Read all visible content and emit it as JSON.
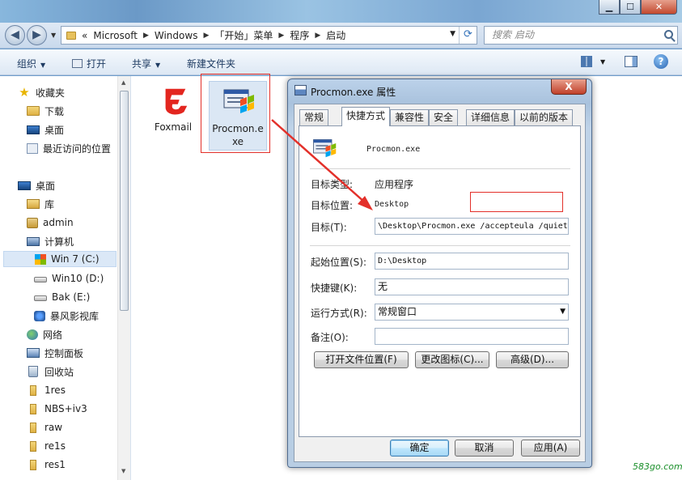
{
  "window": {
    "minimize_icon": "minimize-icon",
    "maximize_icon": "maximize-icon",
    "close_icon": "close-icon"
  },
  "navigation": {
    "back_icon": "back-arrow-icon",
    "forward_icon": "forward-arrow-icon",
    "overflow": "«",
    "breadcrumbs": [
      "Microsoft",
      "Windows",
      "「开始」菜单",
      "程序",
      "启动"
    ],
    "search_placeholder": "搜索 启动"
  },
  "toolbar": {
    "organize": "组织",
    "open": "打开",
    "share": "共享",
    "new_folder": "新建文件夹"
  },
  "sidebar": {
    "items": [
      {
        "label": "收藏夹",
        "icon": "star-icon"
      },
      {
        "label": "下载",
        "icon": "download-folder-icon"
      },
      {
        "label": "桌面",
        "icon": "desktop-icon"
      },
      {
        "label": "最近访问的位置",
        "icon": "recent-places-icon"
      },
      {
        "label": "桌面",
        "icon": "desktop-icon"
      },
      {
        "label": "库",
        "icon": "library-icon"
      },
      {
        "label": "admin",
        "icon": "user-folder-icon"
      },
      {
        "label": "计算机",
        "icon": "computer-icon"
      },
      {
        "label": "Win 7 (C:)",
        "icon": "windows-drive-icon"
      },
      {
        "label": "Win10 (D:)",
        "icon": "drive-icon"
      },
      {
        "label": "Bak (E:)",
        "icon": "drive-icon"
      },
      {
        "label": "暴风影视库",
        "icon": "media-library-icon"
      },
      {
        "label": "网络",
        "icon": "network-icon"
      },
      {
        "label": "控制面板",
        "icon": "control-panel-icon"
      },
      {
        "label": "回收站",
        "icon": "recycle-bin-icon"
      },
      {
        "label": "1res",
        "icon": "folder-icon"
      },
      {
        "label": "NBS+iv3",
        "icon": "folder-icon"
      },
      {
        "label": "raw",
        "icon": "folder-icon"
      },
      {
        "label": "re1s",
        "icon": "folder-icon"
      },
      {
        "label": "res1",
        "icon": "folder-icon"
      }
    ]
  },
  "files": [
    {
      "name": "Foxmail",
      "icon": "foxmail-icon"
    },
    {
      "name_line1": "Procmon.e",
      "name_line2": "xe",
      "icon": "procmon-icon"
    }
  ],
  "dialog": {
    "title": "Procmon.exe 属性",
    "close": "X",
    "tabs": [
      "常规",
      "快捷方式",
      "兼容性",
      "安全",
      "详细信息",
      "以前的版本"
    ],
    "active_tab": "快捷方式",
    "app_name": "Procmon.exe",
    "target_type_label": "目标类型:",
    "target_type_value": "应用程序",
    "target_location_label": "目标位置:",
    "target_location_value": "Desktop",
    "target_label": "目标(T):",
    "target_value": "\\Desktop\\Procmon.exe /accepteula /quiet",
    "start_in_label": "起始位置(S):",
    "start_in_value": "D:\\Desktop",
    "shortcut_key_label": "快捷键(K):",
    "shortcut_key_value": "无",
    "run_label": "运行方式(R):",
    "run_value": "常规窗口",
    "comment_label": "备注(O):",
    "comment_value": "",
    "open_location_btn": "打开文件位置(F)",
    "change_icon_btn": "更改图标(C)...",
    "advanced_btn": "高级(D)...",
    "ok_btn": "确定",
    "cancel_btn": "取消",
    "apply_btn": "应用(A)"
  },
  "watermark": "583go.com",
  "colors": {
    "highlight_red": "#e3302a",
    "selection_blue": "#dbe8f7",
    "watermark_green": "#1a8f2a"
  }
}
